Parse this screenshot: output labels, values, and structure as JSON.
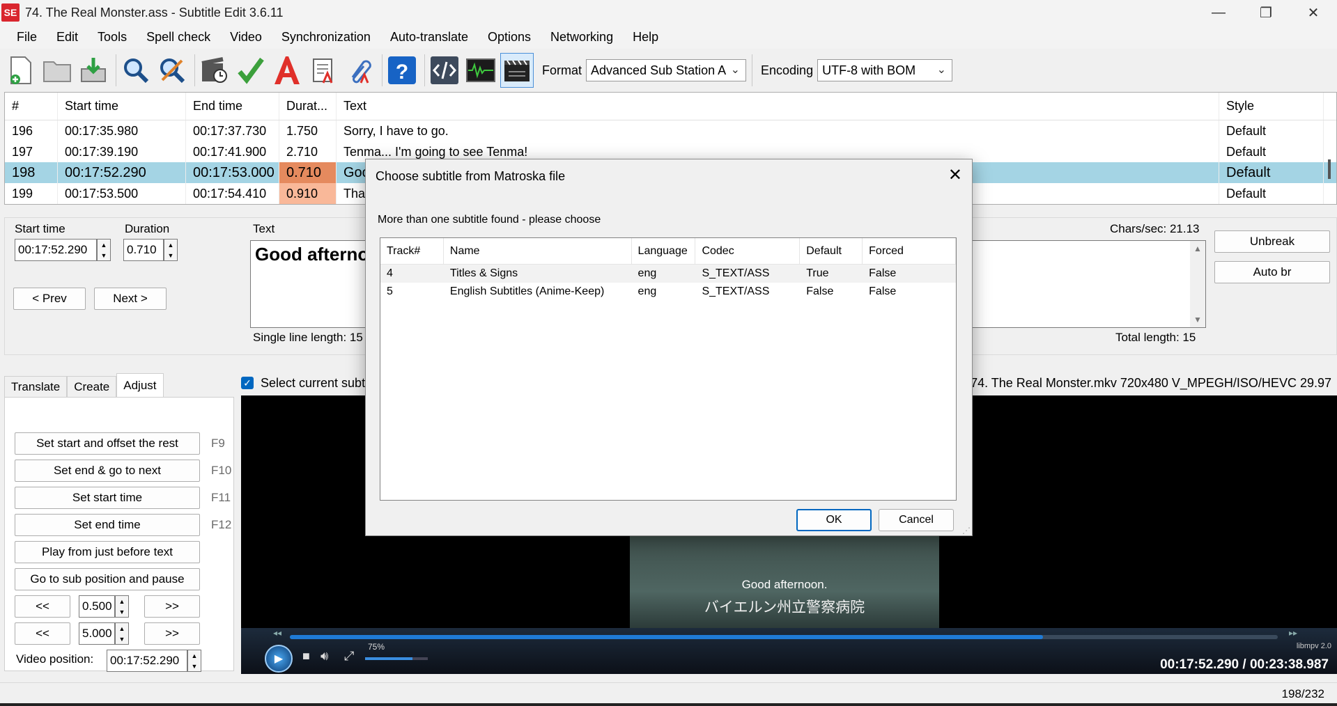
{
  "window": {
    "logo_text": "SE",
    "title": "74. The Real Monster.ass - Subtitle Edit 3.6.11",
    "minimize": "—",
    "restore": "❐",
    "close": "✕"
  },
  "menu": [
    "File",
    "Edit",
    "Tools",
    "Spell check",
    "Video",
    "Synchronization",
    "Auto-translate",
    "Options",
    "Networking",
    "Help"
  ],
  "toolbar": {
    "format_label": "Format",
    "format_value": "Advanced Sub Station A",
    "encoding_label": "Encoding",
    "encoding_value": "UTF-8 with BOM"
  },
  "grid": {
    "headers": {
      "num": "#",
      "start": "Start time",
      "end": "End time",
      "duration": "Durat...",
      "text": "Text",
      "style": "Style"
    },
    "rows": [
      {
        "num": "196",
        "start": "00:17:35.980",
        "end": "00:17:37.730",
        "duration": "1.750",
        "text": "Sorry, I have to go.",
        "style": "Default"
      },
      {
        "num": "197",
        "start": "00:17:39.190",
        "end": "00:17:41.900",
        "duration": "2.710",
        "text": "Tenma... I'm going to see Tenma!",
        "style": "Default"
      },
      {
        "num": "198",
        "start": "00:17:52.290",
        "end": "00:17:53.000",
        "duration": "0.710",
        "text": "Good afternoon.",
        "style": "Default"
      },
      {
        "num": "199",
        "start": "00:17:53.500",
        "end": "00:17:54.410",
        "duration": "0.910",
        "text": "Thank you.",
        "style": "Default"
      }
    ]
  },
  "edit": {
    "start_label": "Start time",
    "start_value": "00:17:52.290",
    "duration_label": "Duration",
    "duration_value": "0.710",
    "text_label": "Text",
    "text_value": "Good afternoon.",
    "prev_label": "< Prev",
    "next_label": "Next >",
    "single_line": "Single line length: 15",
    "chars_sec": "Chars/sec: 21.13",
    "total_length": "Total length: 15",
    "unbreak_label": "Unbreak",
    "autobr_label": "Auto br"
  },
  "tabs": {
    "translate": "Translate",
    "create": "Create",
    "adjust": "Adjust"
  },
  "adjust": {
    "set_start_offset": "Set start and offset the rest",
    "set_start_offset_key": "F9",
    "set_end_next": "Set end & go to next",
    "set_end_next_key": "F10",
    "set_start": "Set start time",
    "set_start_key": "F11",
    "set_end": "Set end time",
    "set_end_key": "F12",
    "play_before": "Play from just before text",
    "goto_sub": "Go to sub position and pause",
    "back": "<<",
    "fwd": ">>",
    "small_step": "0.500",
    "large_step": "5.000",
    "video_pos_label": "Video position:",
    "video_pos_value": "00:17:52.290"
  },
  "video": {
    "select_current": "Select current subtitle while playing",
    "file_info": "74. The Real Monster.mkv 720x480 V_MPEGH/ISO/HEVC 29.97",
    "subtitle_line1": "Good afternoon.",
    "subtitle_line2": "バイエルン州立警察病院",
    "volume_label": "75%",
    "volume_fraction": 0.75,
    "progress_fraction": 0.762,
    "libmpv": "libmpv 2.0",
    "time_display": "00:17:52.290 / 00:23:38.987"
  },
  "status": {
    "count": "198/232"
  },
  "dialog": {
    "title": "Choose subtitle from Matroska file",
    "close": "✕",
    "message": "More than one subtitle found - please choose",
    "headers": {
      "track": "Track#",
      "name": "Name",
      "language": "Language",
      "codec": "Codec",
      "default": "Default",
      "forced": "Forced"
    },
    "rows": [
      {
        "track": "4",
        "name": "Titles & Signs",
        "language": "eng",
        "codec": "S_TEXT/ASS",
        "default": "True",
        "forced": "False"
      },
      {
        "track": "5",
        "name": "English Subtitles (Anime-Keep)",
        "language": "eng",
        "codec": "S_TEXT/ASS",
        "default": "False",
        "forced": "False"
      }
    ],
    "ok_label": "OK",
    "cancel_label": "Cancel"
  }
}
